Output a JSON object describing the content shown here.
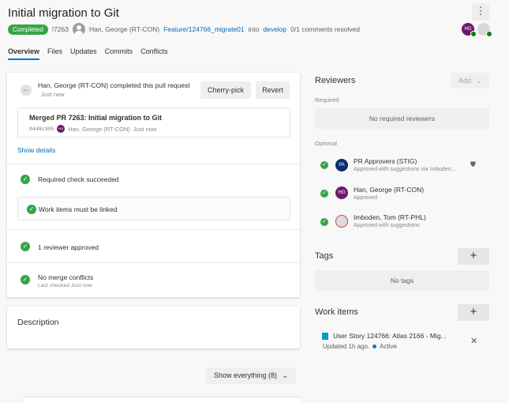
{
  "header": {
    "title": "Initial migration to Git",
    "more": "⋮",
    "status": "Completed",
    "pr_id": "!7263",
    "author": "Han, George (RT-CON)",
    "source_branch": "Feature/124766_migrate01",
    "into": "into",
    "target_branch": "develop",
    "comments": "0/1 comments resolved",
    "avatar_initials": "HG"
  },
  "tabs": [
    "Overview",
    "Files",
    "Updates",
    "Commits",
    "Conflicts"
  ],
  "activity": {
    "message": "Han, George (RT-CON) completed this pull request",
    "time": "Just now",
    "cherry_pick": "Cherry-pick",
    "revert": "Revert",
    "merged_title": "Merged PR 7263: Initial migration to Git",
    "commit_hash": "0448c305",
    "commit_author": "Han, George (RT-CON)",
    "commit_time": "Just now",
    "avatar_initials": "HG",
    "show_details": "Show details"
  },
  "checks": {
    "required_check": "Required check succeeded",
    "work_items_linked": "Work items must be linked",
    "reviewer_approved": "1 reviewer approved",
    "no_conflicts": "No merge conflicts",
    "last_checked": "Last checked Just now"
  },
  "description": {
    "title": "Description"
  },
  "show_everything": "Show everything (8)",
  "reviewers": {
    "title": "Reviewers",
    "add": "Add",
    "required_label": "Required",
    "no_required": "No required reviewers",
    "optional_label": "Optional",
    "items": [
      {
        "initials": "PA",
        "name": "PR Approvers (STIG)",
        "status": "Approved with suggestions via Imboden...",
        "color": "#0b2d6b"
      },
      {
        "initials": "HG",
        "name": "Han, George (RT-CON)",
        "status": "Approved",
        "color": "#6b1a6b"
      },
      {
        "initials": "",
        "name": "Imboden, Tom (RT-PHL)",
        "status": "Approved with suggestions",
        "color": "#d0d0d0"
      }
    ]
  },
  "tags": {
    "title": "Tags",
    "add": "+",
    "empty": "No tags"
  },
  "work_items": {
    "title": "Work items",
    "add": "+",
    "item_title": "User Story 124766: Atlas 2166 - Mig...",
    "updated": "Updated 1h ago.",
    "state": "Active",
    "remove": "✕"
  },
  "colors": {
    "accent": "#0078d4",
    "success": "#37a447",
    "link": "#0068b8"
  }
}
